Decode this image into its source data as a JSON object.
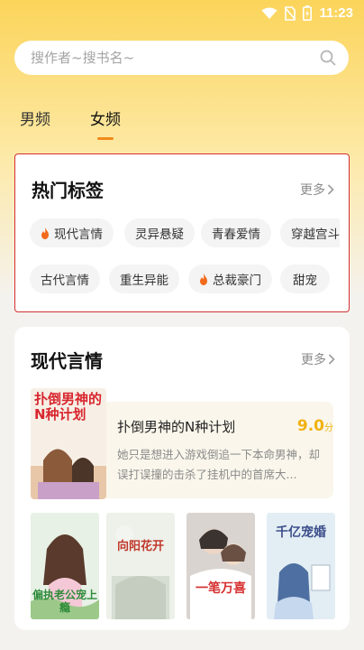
{
  "status_bar": {
    "time": "11:23"
  },
  "search": {
    "placeholder": "搜作者~搜书名~"
  },
  "tabs": [
    {
      "label": "男频",
      "active": false
    },
    {
      "label": "女频",
      "active": true
    }
  ],
  "accent_color": "#f08a1c",
  "hot_tags": {
    "title": "热门标签",
    "more_label": "更多",
    "row1": [
      {
        "label": "现代言情",
        "hot": true
      },
      {
        "label": "灵异悬疑",
        "hot": false
      },
      {
        "label": "青春爱情",
        "hot": false
      },
      {
        "label": "穿越宫斗",
        "hot": false
      }
    ],
    "row2": [
      {
        "label": "古代言情",
        "hot": false
      },
      {
        "label": "重生异能",
        "hot": false
      },
      {
        "label": "总裁豪门",
        "hot": true
      },
      {
        "label": "甜宠",
        "hot": false
      }
    ]
  },
  "section": {
    "title": "现代言情",
    "more_label": "更多",
    "featured": {
      "title": "扑倒男神的N种计划",
      "score": "9.0",
      "score_unit": "分",
      "description": "她只是想进入游戏倒追一下本命男神，却误打误撞的击杀了挂机中的首席大...",
      "cover_text": "扑倒男神的N种计划"
    },
    "covers": [
      {
        "cover_text": "偏执老公宠上瘾"
      },
      {
        "cover_text": "向阳花开"
      },
      {
        "cover_text": "一笔万喜"
      },
      {
        "cover_text": "千亿宠婚"
      }
    ]
  }
}
